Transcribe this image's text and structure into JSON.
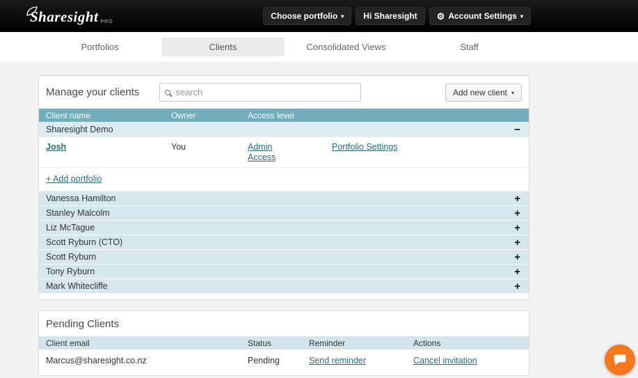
{
  "topbar": {
    "brand": "Sharesight",
    "brand_sub": "PRO",
    "choose_portfolio_label": "Choose portfolio",
    "greeting_label": "Hi Sharesight",
    "account_settings_label": "Account Settings"
  },
  "nav": {
    "tabs": [
      {
        "label": "Portfolios"
      },
      {
        "label": "Clients"
      },
      {
        "label": "Consolidated Views"
      },
      {
        "label": "Staff"
      }
    ]
  },
  "manage": {
    "title": "Manage your clients",
    "search_placeholder": "search",
    "add_client_label": "Add new client",
    "headers": [
      "Client name",
      "Owner",
      "Access level"
    ],
    "expanded_client": {
      "name": "Sharesight Demo",
      "portfolio": {
        "name": "Josh",
        "owner": "You",
        "access": "Admin Access",
        "settings": "Portfolio Settings"
      },
      "add_portfolio_label": "+ Add portfolio"
    },
    "clients": [
      {
        "name": "Vanessa Hamilton"
      },
      {
        "name": "Stanley Malcolm"
      },
      {
        "name": "Liz McTague"
      },
      {
        "name": "Scott Ryburn (CTO)"
      },
      {
        "name": "Scott Ryburn"
      },
      {
        "name": "Tony Ryburn"
      },
      {
        "name": "Mark Whitecliffe"
      }
    ]
  },
  "pending": {
    "title": "Pending Clients",
    "headers": [
      "Client email",
      "Status",
      "Reminder",
      "Actions"
    ],
    "rows": [
      {
        "email": "Marcus@sharesight.co.nz",
        "status": "Pending",
        "reminder": "Send reminder",
        "action": "Cancel invitation"
      }
    ]
  },
  "icons": {
    "gear": "⚙",
    "caret": "▾",
    "plus": "+",
    "minus": "−"
  },
  "colors": {
    "header_teal": "#71adbb",
    "row_blue": "#d6e8ee",
    "link": "#2a6b7c",
    "chat_orange": "#f8771d"
  }
}
